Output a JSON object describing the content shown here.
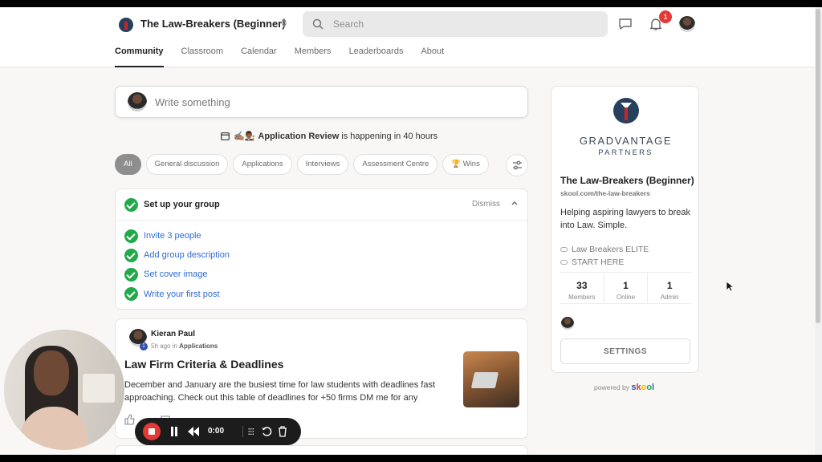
{
  "header": {
    "group_name": "The Law-Breakers (Beginner)",
    "search_placeholder": "Search",
    "notification_count": "1"
  },
  "nav": {
    "tabs": [
      {
        "label": "Community",
        "active": true
      },
      {
        "label": "Classroom"
      },
      {
        "label": "Calendar"
      },
      {
        "label": "Members"
      },
      {
        "label": "Leaderboards"
      },
      {
        "label": "About"
      }
    ]
  },
  "composer": {
    "placeholder": "Write something"
  },
  "event": {
    "emoji": "✍🏽👨🏾‍⚖️",
    "name": "Application Review",
    "suffix": "is happening in 40 hours"
  },
  "filters": {
    "chips": [
      "All",
      "General discussion",
      "Applications",
      "Interviews",
      "Assessment Centre",
      "🏆 Wins"
    ]
  },
  "setup": {
    "title": "Set up your group",
    "dismiss": "Dismiss",
    "items": [
      "Invite 3 people",
      "Add group description",
      "Set cover image",
      "Write your first post"
    ]
  },
  "post": {
    "author": "Kieran Paul",
    "level": "1",
    "time": "5h ago",
    "in_word": "in",
    "category": "Applications",
    "title": "Law Firm Criteria & Deadlines",
    "body": "December and January are the busiest time for law students with deadlines fast approaching. Check out this table of deadlines for +50 firms DM me for any"
  },
  "sidebar": {
    "brand_line1": "GRADVANTAGE",
    "brand_line2": "PARTNERS",
    "group_name": "The Law-Breakers (Beginner)",
    "url": "skool.com/the-law-breakers",
    "description": "Helping aspiring lawyers to break into Law. Simple.",
    "links": [
      "Law Breakers ELITE",
      "START HERE"
    ],
    "stats": [
      {
        "value": "33",
        "label": "Members"
      },
      {
        "value": "1",
        "label": "Online"
      },
      {
        "value": "1",
        "label": "Admin"
      }
    ],
    "settings_label": "SETTINGS"
  },
  "powered": {
    "prefix": "powered by",
    "brand": [
      "s",
      "k",
      "o",
      "o",
      "l"
    ]
  },
  "recorder": {
    "time": "0:00"
  },
  "colors": {
    "accent_green": "#21a94a",
    "link_blue": "#2f6bd3",
    "badge_red": "#e53935",
    "active_chip": "#8e8e8e"
  }
}
